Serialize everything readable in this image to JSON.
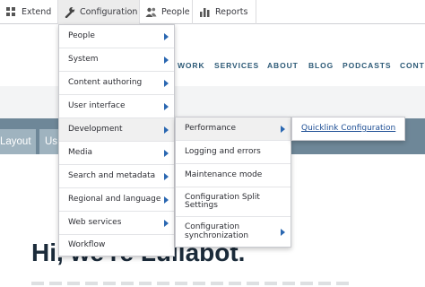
{
  "toolbar": {
    "items": [
      {
        "label": "Extend",
        "icon": "extend-icon"
      },
      {
        "label": "Configuration",
        "icon": "wrench-icon"
      },
      {
        "label": "People",
        "icon": "people-icon"
      },
      {
        "label": "Reports",
        "icon": "reports-icon"
      }
    ]
  },
  "site_nav": [
    "WORK",
    "SERVICES",
    "ABOUT",
    "BLOG",
    "PODCASTS",
    "CONT"
  ],
  "tasks": [
    "Layout",
    "Us"
  ],
  "hero_text": "Hi, we're Lullabot.",
  "menu_level1": [
    {
      "label": "People",
      "has_children": true
    },
    {
      "label": "System",
      "has_children": true
    },
    {
      "label": "Content authoring",
      "has_children": true
    },
    {
      "label": "User interface",
      "has_children": true
    },
    {
      "label": "Development",
      "has_children": true
    },
    {
      "label": "Media",
      "has_children": true
    },
    {
      "label": "Search and metadata",
      "has_children": true
    },
    {
      "label": "Regional and language",
      "has_children": true
    },
    {
      "label": "Web services",
      "has_children": true
    },
    {
      "label": "Workflow",
      "has_children": false
    }
  ],
  "menu_level2": [
    {
      "label": "Performance",
      "has_children": true
    },
    {
      "label": "Logging and errors",
      "has_children": false
    },
    {
      "label": "Maintenance mode",
      "has_children": false
    },
    {
      "label": "Configuration Split Settings",
      "has_children": false
    },
    {
      "label": "Configuration synchronization",
      "has_children": true
    }
  ],
  "menu_level3": [
    {
      "label": "Quicklink Configuration"
    }
  ],
  "colors": {
    "accent_link": "#1e4f95",
    "arrow": "#2a67b1",
    "nav_text": "#2d5a77",
    "tasks_band": "#6e8798"
  }
}
